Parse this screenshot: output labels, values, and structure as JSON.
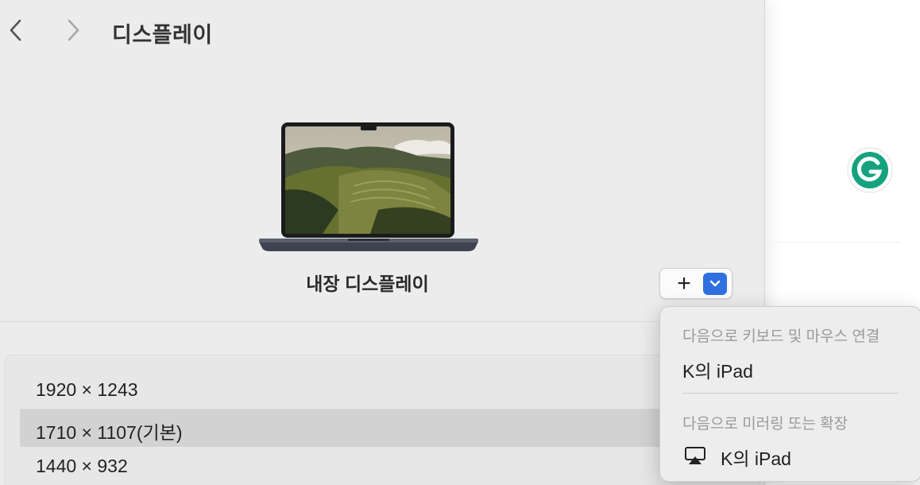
{
  "window": {
    "title": "디스플레이"
  },
  "display": {
    "name": "내장 디스플레이",
    "add_symbol": "+"
  },
  "resolutions": [
    {
      "label": "1920 × 1243",
      "selected": false
    },
    {
      "label": "1710 × 1107(기본)",
      "selected": true
    },
    {
      "label": "1440 × 932",
      "selected": false
    }
  ],
  "menu": {
    "section1_header": "다음으로 키보드 및 마우스 연결",
    "section1_item": "K의 iPad",
    "section2_header": "다음으로 미러링 또는 확장",
    "section2_item": "K의 iPad"
  },
  "colors": {
    "accent": "#2f6fe0",
    "grammarly": "#15a37f"
  },
  "icons": {
    "back": "chevron-left-icon",
    "forward": "chevron-right-icon",
    "dropdown": "chevron-down-icon",
    "airplay": "airplay-icon",
    "extension": "grammarly-icon"
  }
}
